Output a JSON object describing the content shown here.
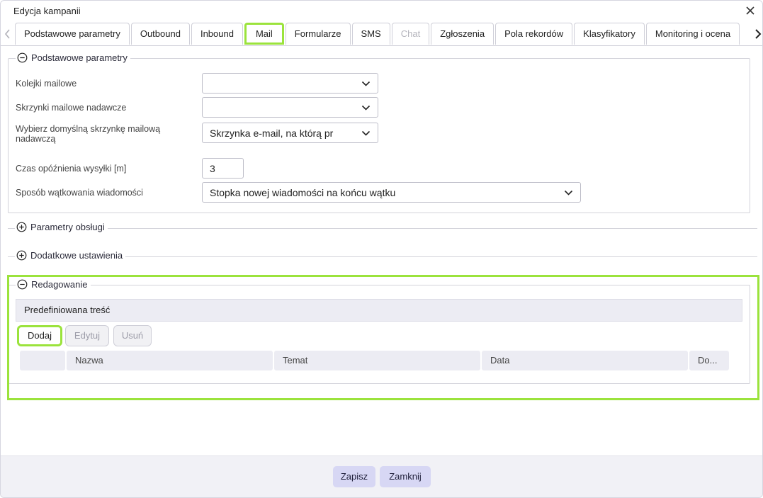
{
  "dialog": {
    "title": "Edycja kampanii"
  },
  "tabs": [
    {
      "label": "Podstawowe parametry",
      "state": "normal"
    },
    {
      "label": "Outbound",
      "state": "normal"
    },
    {
      "label": "Inbound",
      "state": "normal"
    },
    {
      "label": "Mail",
      "state": "active"
    },
    {
      "label": "Formularze",
      "state": "normal"
    },
    {
      "label": "SMS",
      "state": "normal"
    },
    {
      "label": "Chat",
      "state": "disabled"
    },
    {
      "label": "Zgłoszenia",
      "state": "normal"
    },
    {
      "label": "Pola rekordów",
      "state": "normal"
    },
    {
      "label": "Klasyfikatory",
      "state": "normal"
    },
    {
      "label": "Monitoring i ocena",
      "state": "normal"
    }
  ],
  "basic": {
    "legend": "Podstawowe parametry",
    "mail_queues": {
      "label": "Kolejki mailowe",
      "value": ""
    },
    "sender_mailboxes": {
      "label": "Skrzynki mailowe nadawcze",
      "value": ""
    },
    "default_mailbox": {
      "label": "Wybierz domyślną skrzynkę mailową nadawczą",
      "value": "Skrzynka e-mail, na którą pr"
    },
    "send_delay": {
      "label": "Czas opóźnienia wysyłki [m]",
      "value": "3"
    },
    "threading": {
      "label": "Sposób wątkowania wiadomości",
      "value": "Stopka nowej wiadomości na końcu wątku"
    }
  },
  "service_params": {
    "legend": "Parametry obsługi"
  },
  "extra_settings": {
    "legend": "Dodatkowe ustawienia"
  },
  "editing": {
    "legend": "Redagowanie",
    "subheader": "Predefiniowana treść",
    "buttons": {
      "add": "Dodaj",
      "edit": "Edytuj",
      "delete": "Usuń"
    },
    "columns": [
      "",
      "Nazwa",
      "Temat",
      "Data",
      "Do..."
    ]
  },
  "footer": {
    "save": "Zapisz",
    "close": "Zamknij"
  },
  "colors": {
    "accent_highlight": "#9be33c",
    "footer_button": "#d7d7f4",
    "header_bg": "#ececf3"
  },
  "icons": {
    "close": "close-icon",
    "expand": "plus-circle-icon",
    "collapse": "minus-circle-icon",
    "dropdown": "chevron-down-icon"
  }
}
